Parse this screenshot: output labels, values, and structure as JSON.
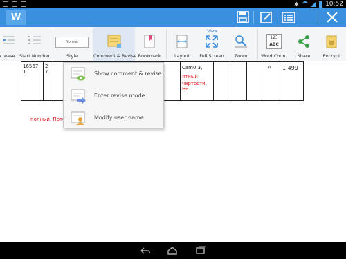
{
  "status_bar": {
    "time": "10:52"
  },
  "app": {
    "logo": "W"
  },
  "toolbar": {
    "save_icon": "save-icon",
    "edit_icon": "pencil-icon",
    "menu_icon": "list-icon",
    "close_icon": "close-icon"
  },
  "ribbon": {
    "view_group": "View",
    "items": {
      "increase": "crease",
      "start_number": "Start Number",
      "style": "Style",
      "style_preview": "Normal",
      "comment_revise": "Comment & Revise",
      "bookmark": "Bookmark",
      "layout": "Layout",
      "full_screen": "Full Screen",
      "zoom": "Zoom",
      "word_count": "Word Count",
      "word_count_icon_top": "123",
      "word_count_icon_bottom": "ABC",
      "share": "Share",
      "encrypt": "Encrypt"
    }
  },
  "popup": {
    "items": [
      {
        "label": "Show comment & revise",
        "icon": "comment-eye-icon"
      },
      {
        "label": "Enter revise mode",
        "icon": "revise-arrow-icon"
      },
      {
        "label": "Modify user name",
        "icon": "user-comment-icon"
      }
    ]
  },
  "document": {
    "cell_number": "16567",
    "cell_number2": "1",
    "cell_blue_top": "2",
    "cell_blue_bottom": "7",
    "cell_text1": "Cam0,3,",
    "cell_red1": "ятный",
    "cell_red2": "чертости. Не",
    "cell_a": "A",
    "cell_value": "1 499",
    "red_line": "полный. Поте"
  },
  "colors": {
    "title_bar": "#3a8fde",
    "ribbon_bg": "#f4f5f7",
    "accent_red": "#e02020",
    "accent_blue": "#2a6ad3"
  }
}
